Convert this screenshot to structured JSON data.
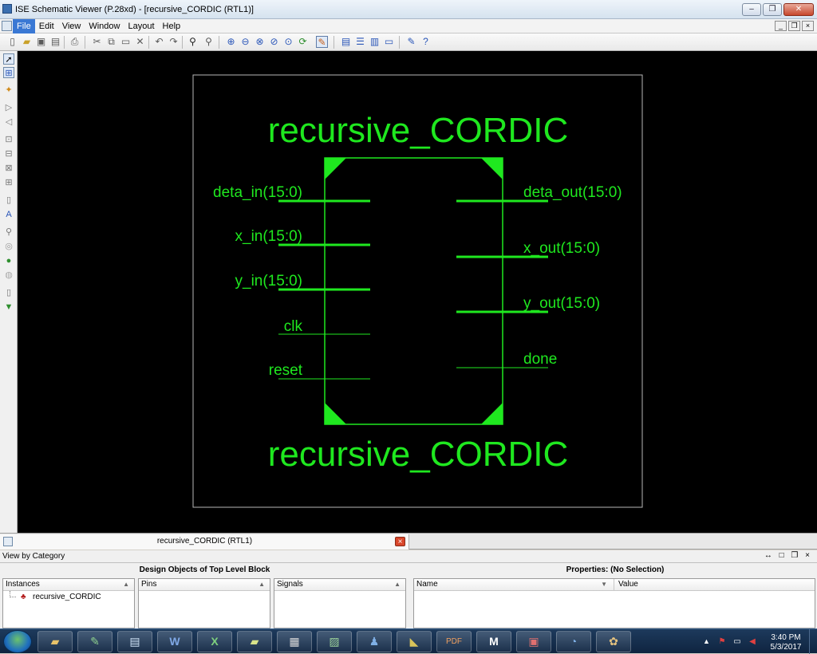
{
  "window": {
    "title": "ISE Schematic Viewer (P.28xd) - [recursive_CORDIC (RTL1)]"
  },
  "menu": {
    "items": [
      "File",
      "Edit",
      "View",
      "Window",
      "Layout",
      "Help"
    ],
    "active": "File"
  },
  "schematic": {
    "top_label": "recursive_CORDIC",
    "bottom_label": "recursive_CORDIC",
    "inputs": [
      "deta_in(15:0)",
      "x_in(15:0)",
      "y_in(15:0)",
      "clk",
      "reset"
    ],
    "outputs": [
      "deta_out(15:0)",
      "x_out(15:0)",
      "y_out(15:0)",
      "done"
    ],
    "colors": {
      "wire": "#1fe81f",
      "background": "#000000",
      "frame": "#b8b8b8"
    }
  },
  "doc_tab": {
    "label": "recursive_CORDIC (RTL1)"
  },
  "panel": {
    "header": "View by Category",
    "left_title": "Design Objects of Top Level Block",
    "right_title": "Properties: (No Selection)",
    "instances_header": "Instances",
    "instance_item": "recursive_CORDIC",
    "pins_header": "Pins",
    "signals_header": "Signals",
    "name_header": "Name",
    "value_header": "Value"
  },
  "clock": {
    "time": "3:40 PM",
    "date": "5/3/2017"
  }
}
